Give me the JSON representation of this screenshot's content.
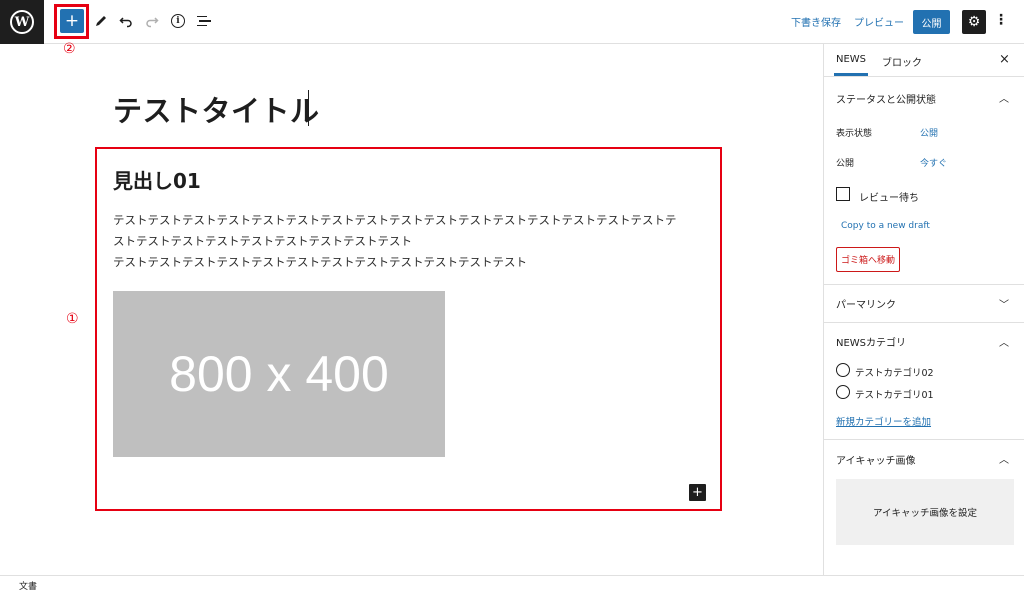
{
  "toolbar": {
    "wp_logo": "W",
    "add_block": "+",
    "save_draft": "下書き保存",
    "preview": "プレビュー",
    "publish": "公開",
    "settings_icon": "⚙",
    "more_icon": "⋮",
    "icons": [
      "pencil-icon",
      "undo-icon",
      "redo-icon",
      "info-icon",
      "list-view-icon"
    ]
  },
  "annotations": {
    "marker_1": "①",
    "marker_2": "②",
    "highlight_color": "#e60012"
  },
  "editor": {
    "title": "テストタイトル",
    "heading": "見出し01",
    "paragraph_lines": [
      "テストテストテストテストテストテストテストテストテストテストテストテストテストテストテストテストテ",
      "ストテストテストテストテストテストテストテストテスト",
      "テストテストテストテストテストテストテストテストテストテストテストテスト"
    ],
    "image_label": "800 x 400",
    "inserter": "+"
  },
  "sidebar": {
    "tab_post": "NEWS",
    "tab_block": "ブロック",
    "close": "×",
    "status_panel": {
      "title": "ステータスと公開状態",
      "visibility_label": "表示状態",
      "visibility_value": "公開",
      "publish_label": "公開",
      "publish_value": "今すぐ",
      "pending_review": "レビュー待ち",
      "copy_draft": "Copy to a new draft",
      "trash": "ゴミ箱へ移動"
    },
    "permalink_panel": {
      "title": "パーマリンク"
    },
    "category_panel": {
      "title": "NEWSカテゴリ",
      "categories": [
        "テストカテゴリ02",
        "テストカテゴリ01"
      ],
      "add_new": "新規カテゴリーを追加"
    },
    "featured_panel": {
      "title": "アイキャッチ画像",
      "set_button": "アイキャッチ画像を設定"
    }
  },
  "footer": {
    "breadcrumb": "文書"
  },
  "colors": {
    "accent": "#2271b1",
    "dark": "#1e1e1e",
    "danger": "#cc1818"
  }
}
